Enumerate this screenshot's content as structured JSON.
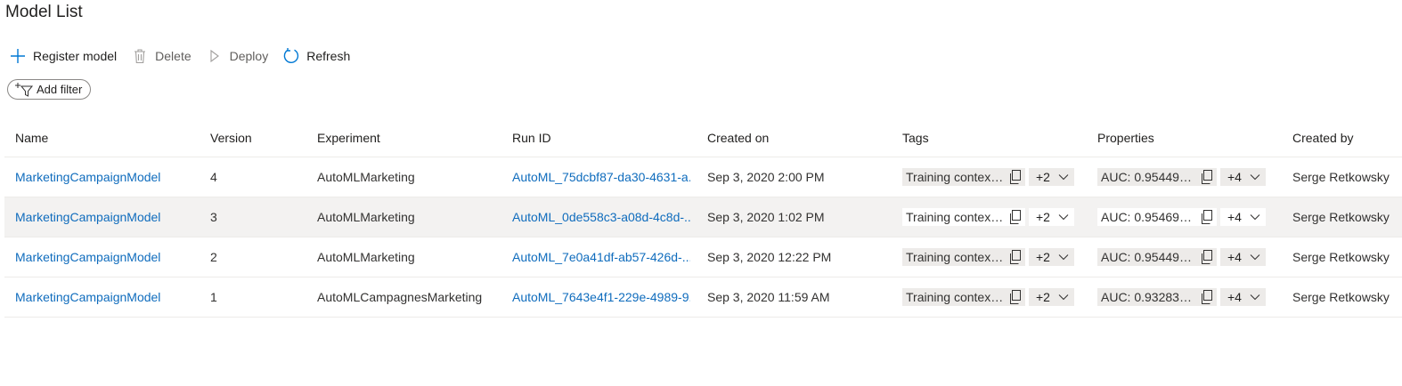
{
  "page": {
    "title": "Model List"
  },
  "toolbar": {
    "register_label": "Register model",
    "delete_label": "Delete",
    "deploy_label": "Deploy",
    "refresh_label": "Refresh"
  },
  "filter": {
    "add_label": "Add filter"
  },
  "table": {
    "columns": {
      "name": "Name",
      "version": "Version",
      "experiment": "Experiment",
      "run_id": "Run ID",
      "created_on": "Created on",
      "tags": "Tags",
      "properties": "Properties",
      "created_by": "Created by"
    },
    "rows": [
      {
        "name": "MarketingCampaignModel",
        "version": "4",
        "experiment": "AutoMLMarketing",
        "run_id": "AutoML_75dcbf87-da30-4631-a...",
        "created_on": "Sep 3, 2020 2:00 PM",
        "tag": "Training context:...",
        "tag_more": "+2",
        "property": "AUC: 0.9544953...",
        "property_more": "+4",
        "created_by": "Serge Retkowsky"
      },
      {
        "name": "MarketingCampaignModel",
        "version": "3",
        "experiment": "AutoMLMarketing",
        "run_id": "AutoML_0de558c3-a08d-4c8d-...",
        "created_on": "Sep 3, 2020 1:02 PM",
        "tag": "Training context:...",
        "tag_more": "+2",
        "property": "AUC: 0.9546916...",
        "property_more": "+4",
        "created_by": "Serge Retkowsky"
      },
      {
        "name": "MarketingCampaignModel",
        "version": "2",
        "experiment": "AutoMLMarketing",
        "run_id": "AutoML_7e0a41df-ab57-426d-...",
        "created_on": "Sep 3, 2020 12:22 PM",
        "tag": "Training context:...",
        "tag_more": "+2",
        "property": "AUC: 0.9544953...",
        "property_more": "+4",
        "created_by": "Serge Retkowsky"
      },
      {
        "name": "MarketingCampaignModel",
        "version": "1",
        "experiment": "AutoMLCampagnesMarketing",
        "run_id": "AutoML_7643e4f1-229e-4989-9...",
        "created_on": "Sep 3, 2020 11:59 AM",
        "tag": "Training context:...",
        "tag_more": "+2",
        "property": "AUC: 0.9328369...",
        "property_more": "+4",
        "created_by": "Serge Retkowsky"
      }
    ]
  },
  "icons": {
    "register": "plus-icon",
    "delete": "trash-icon",
    "deploy": "play-icon",
    "refresh": "refresh-icon",
    "filter": "add-filter-icon",
    "copy": "copy-icon",
    "expand": "chevron-down-icon"
  },
  "colors": {
    "link": "#0f6cbd",
    "accent": "#0078d4",
    "row_alt": "#f3f2f1",
    "chip": "#edebe9"
  }
}
